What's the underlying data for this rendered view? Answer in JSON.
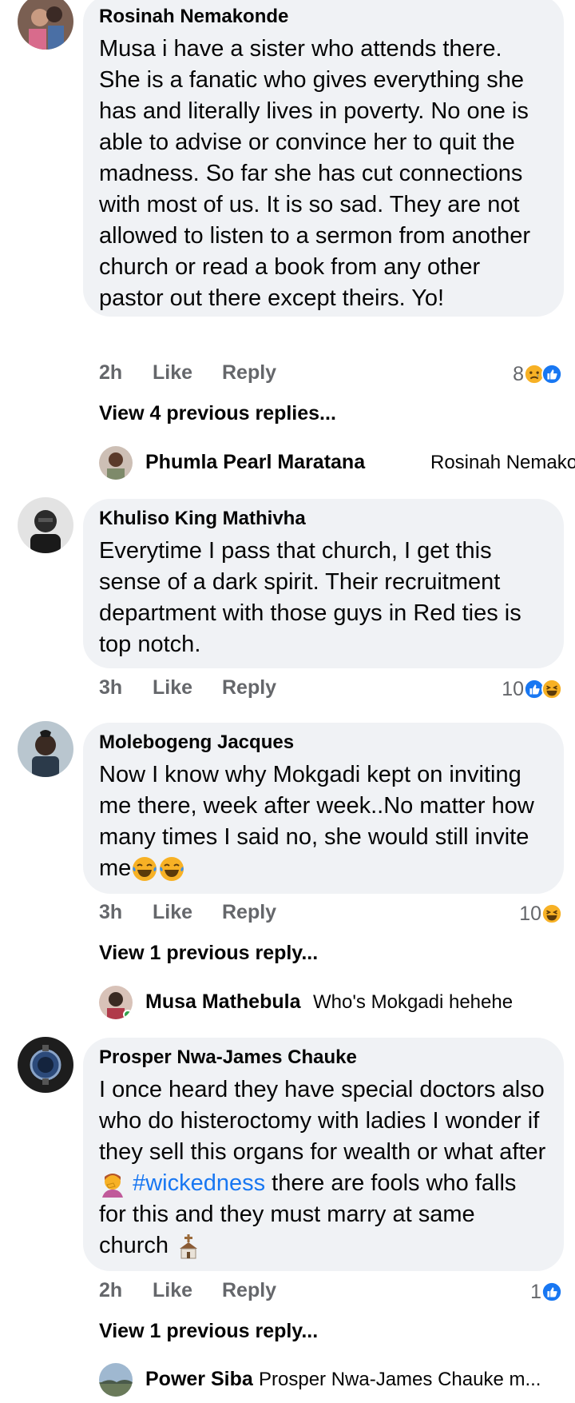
{
  "comments": [
    {
      "author": "Rosinah Nemakonde",
      "text": "Musa i have a sister who attends there. She is a fanatic who gives everything she has and literally lives in poverty.  No one is able to advise or convince her to quit the madness. So far she has cut connections with most of us. It is so sad. They are not allowed to listen to a sermon from another church or read a book from any other pastor out there except theirs. Yo!",
      "time": "2h",
      "like_label": "Like",
      "reply_label": "Reply",
      "reaction_count": "8",
      "reactions": [
        "sad",
        "like"
      ],
      "view_more": "View 4 previous replies...",
      "reply_preview": {
        "author": "Phumla Pearl Maratana",
        "text": "Rosinah Nemakon..."
      }
    },
    {
      "author": "Khuliso King Mathivha",
      "text": "Everytime I pass that church, I get this sense of a dark spirit. Their recruitment department with those guys in Red ties is top notch.",
      "time": "3h",
      "like_label": "Like",
      "reply_label": "Reply",
      "reaction_count": "10",
      "reactions": [
        "like",
        "haha"
      ]
    },
    {
      "author": "Molebogeng Jacques",
      "text_before": "Now I know why Mokgadi kept on inviting me there, week after week..No matter how many times I said no, she would still invite me",
      "time": "3h",
      "like_label": "Like",
      "reply_label": "Reply",
      "reaction_count": "10",
      "reactions": [
        "haha"
      ],
      "view_more": "View 1 previous reply...",
      "reply_preview": {
        "author": "Musa Mathebula",
        "text": "Who's Mokgadi hehehe"
      }
    },
    {
      "author": "Prosper Nwa-James Chauke",
      "text_part1": "I once heard they have special doctors also who do histeroctomy with ladies I wonder if they sell this organs for wealth or what after",
      "hashtag": "#wickedness",
      "text_part2": "there are fools who falls for this and they must marry at same church",
      "time": "2h",
      "like_label": "Like",
      "reply_label": "Reply",
      "reaction_count": "1",
      "reactions": [
        "like"
      ],
      "view_more": "View 1 previous reply...",
      "reply_preview": {
        "author": "Power Siba",
        "text": "Prosper Nwa-James Chauke m..."
      }
    }
  ],
  "colors": {
    "bubble": "#f0f2f5",
    "muted": "#65676b",
    "link": "#1877f2",
    "like": "#1877f2",
    "emoji": "#f7b125"
  }
}
